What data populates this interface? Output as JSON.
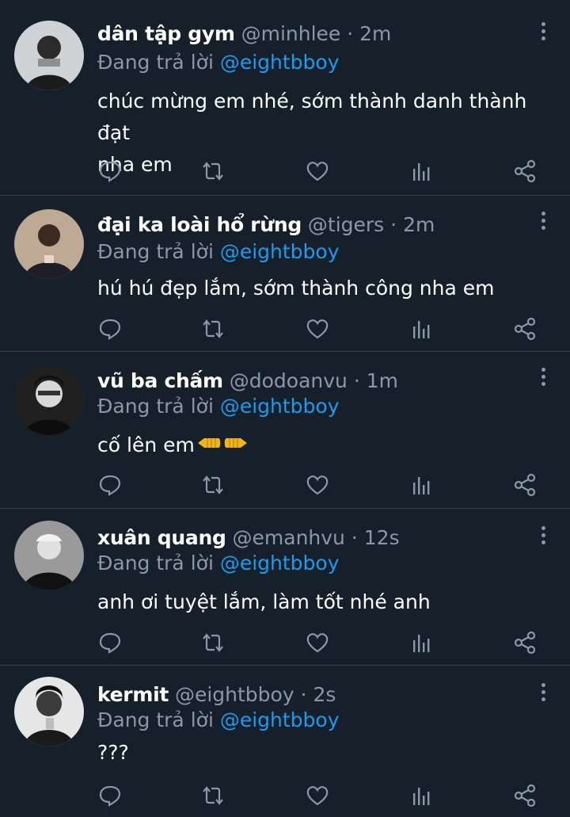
{
  "replying_prefix": "Đang trả lời",
  "colors": {
    "background": "#15202b",
    "divider": "#38444d",
    "secondary_text": "#8b98a5",
    "link": "#1d9bf0"
  },
  "tweets": [
    {
      "name": "dân tập gym",
      "handle": "@minhlee",
      "separator": "·",
      "time": "2m",
      "reply_to": "@eightbboy",
      "text_line1": "chúc mừng em nhé, sớm thành danh thành đạt",
      "text_line2": "nha em",
      "avatar_icon": "person-avatar"
    },
    {
      "name": "đại ka loài hổ rừng",
      "handle": "@tigers",
      "separator": "·",
      "time": "2m",
      "reply_to": "@eightbboy",
      "text_line1": "hú hú đẹp lắm, sớm thành công nha em",
      "avatar_icon": "person-avatar"
    },
    {
      "name": "vũ ba chấm",
      "handle": "@dodoanvu",
      "separator": "·",
      "time": "1m",
      "reply_to": "@eightbboy",
      "text_line1": "cố lên em",
      "emoji_icons": [
        "left-facing-fist-emoji",
        "right-facing-fist-emoji"
      ],
      "avatar_icon": "person-avatar"
    },
    {
      "name": "xuân quang",
      "handle": "@emanhvu",
      "separator": "·",
      "time": "12s",
      "reply_to": "@eightbboy",
      "text_line1": "anh ơi tuyệt lắm, làm tốt nhé anh",
      "avatar_icon": "person-avatar"
    },
    {
      "name": "kermit",
      "handle": "@eightbboy",
      "separator": "·",
      "time": "2s",
      "reply_to": "@eightbboy",
      "text_line1": "???",
      "avatar_icon": "person-avatar"
    }
  ],
  "action_icons": [
    "reply-icon",
    "retweet-icon",
    "like-icon",
    "analytics-icon",
    "share-icon"
  ]
}
